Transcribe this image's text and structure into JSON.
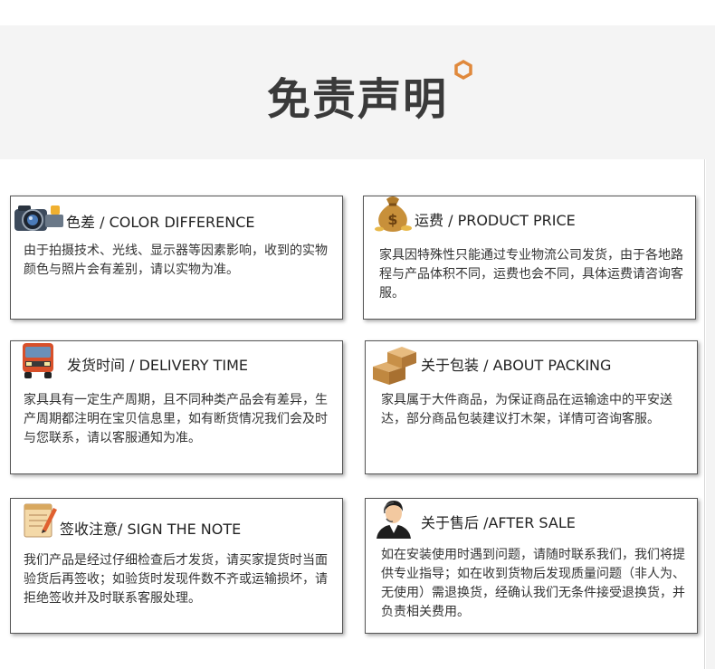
{
  "header": {
    "title": "免责声明",
    "accent_color": "#e0893c"
  },
  "cards": {
    "color": {
      "icon": "camera-icon",
      "title": "色差 / COLOR DIFFERENCE",
      "body": "由于拍摄技术、光线、显示器等因素影响，收到的实物颜色与照片会有差别，请以实物为准。"
    },
    "price": {
      "icon": "money-bag-icon",
      "title": "运费 / PRODUCT PRICE",
      "body": "家具因特殊性只能通过专业物流公司发货，由于各地路程与产品体积不同，运费也会不同，具体运费请咨询客服。"
    },
    "delivery": {
      "icon": "truck-icon",
      "title": "发货时间 / DELIVERY TIME",
      "body": "家具具有一定生产周期，且不同种类产品会有差异，生产周期都注明在宝贝信息里，如有断货情况我们会及时与您联系，请以客服通知为准。"
    },
    "packing": {
      "icon": "boxes-icon",
      "title": "关于包装 / ABOUT PACKING",
      "body": "家具属于大件商品，为保证商品在运输途中的平安送达，部分商品包装建议打木架，详情可咨询客服。"
    },
    "sign": {
      "icon": "notepad-icon",
      "title": "签收注意/ SIGN THE NOTE",
      "body": "我们产品是经过仔细检查后才发货，请买家提货时当面验货后再签收；如验货时发现件数不齐或运输损坏，请拒绝签收并及时联系客服处理。"
    },
    "aftersale": {
      "icon": "customer-service-icon",
      "title": "关于售后 /AFTER SALE",
      "body": "如在安装使用时遇到问题，请随时联系我们，我们将提供专业指导；如在收到货物后发现质量问题（非人为、无使用）需退换货，经确认我们无条件接受退换货，并负责相关费用。"
    }
  }
}
